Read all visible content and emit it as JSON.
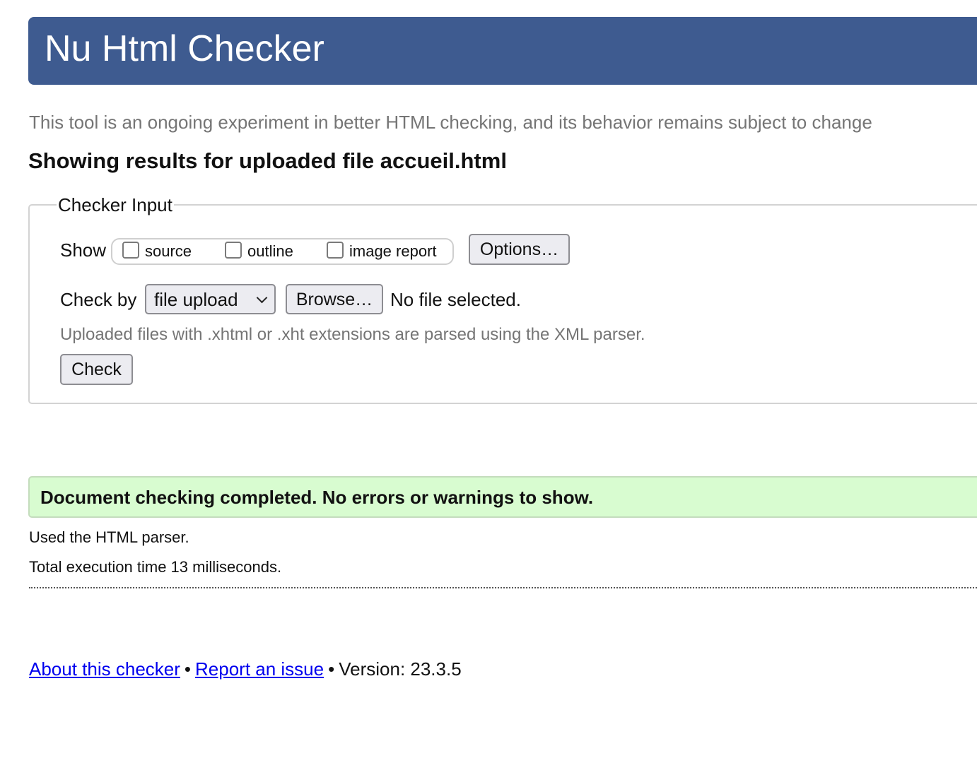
{
  "header": {
    "title": "Nu Html Checker"
  },
  "tagline": "This tool is an ongoing experiment in better HTML checking, and its behavior remains subject to change",
  "results_heading": "Showing results for uploaded file accueil.html",
  "checker_input": {
    "legend": "Checker Input",
    "show_label": "Show",
    "show_options": [
      {
        "label": "source",
        "checked": false
      },
      {
        "label": "outline",
        "checked": false
      },
      {
        "label": "image report",
        "checked": false
      }
    ],
    "options_button": "Options…",
    "check_by_label": "Check by",
    "check_by_selected": "file upload",
    "browse_button": "Browse…",
    "file_status": "No file selected.",
    "note": "Uploaded files with .xhtml or .xht extensions are parsed using the XML parser.",
    "check_button": "Check"
  },
  "result": {
    "message": "Document checking completed. No errors or warnings to show.",
    "parser": "Used the HTML parser.",
    "execution_time": "Total execution time 13 milliseconds."
  },
  "footer": {
    "about_link": "About this checker",
    "separator": "•",
    "report_link": "Report an issue",
    "version": "Version: 23.3.5"
  },
  "colors": {
    "header_bg": "#3e5b90",
    "success_bg": "#d8fcd0",
    "link": "#0000ee",
    "muted_text": "#757575"
  }
}
